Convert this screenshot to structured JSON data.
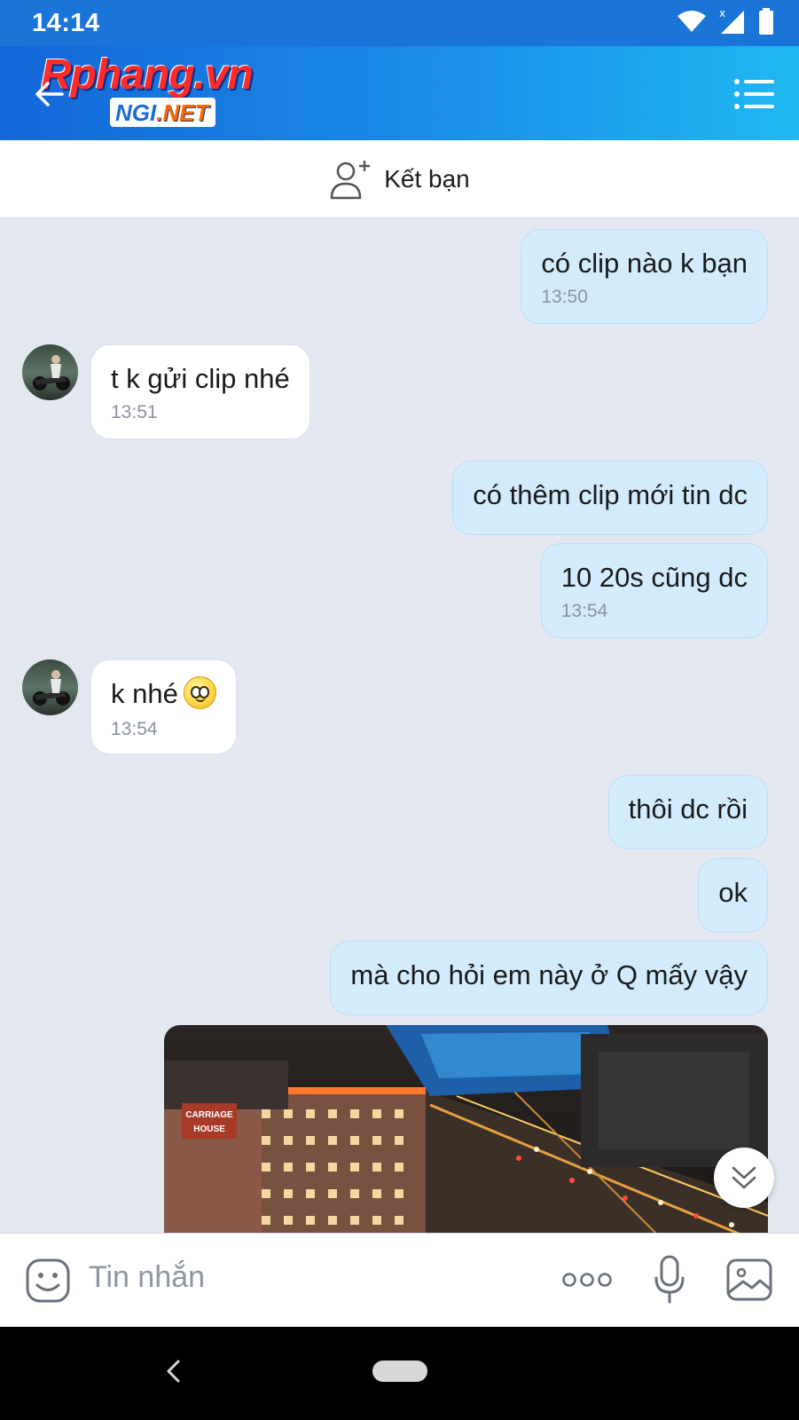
{
  "status_bar": {
    "time": "14:14"
  },
  "header": {
    "logo_main": "Rphang.vn",
    "logo_sub_a": "NGI",
    "logo_sub_b": ".NET"
  },
  "friend_bar": {
    "label": "Kết bạn"
  },
  "messages": [
    {
      "side": "out",
      "text": "có clip nào k bạn",
      "time": "13:50"
    },
    {
      "side": "in",
      "text": "t k gửi clip nhé",
      "time": "13:51"
    },
    {
      "side": "out",
      "text": "có thêm clip mới tin dc",
      "time": ""
    },
    {
      "side": "out",
      "text": "10 20s cũng dc",
      "time": "13:54"
    },
    {
      "side": "in",
      "text": "k nhé",
      "time": "13:54",
      "emoji": "smiley-emoji"
    },
    {
      "side": "out",
      "text": "thôi dc rồi",
      "time": ""
    },
    {
      "side": "out",
      "text": "ok",
      "time": ""
    },
    {
      "side": "out",
      "text": "mà cho hỏi em này ở Q mấy vậy",
      "time": ""
    }
  ],
  "photo": {
    "sign_line1": "CARRIAGE",
    "sign_line2": "HOUSE"
  },
  "input": {
    "placeholder": "Tin nhắn"
  },
  "icons": {
    "back": "back-arrow-icon",
    "menu": "menu-icon",
    "add_friend": "add-friend-icon",
    "sticker": "sticker-icon",
    "more": "more-icon",
    "mic": "microphone-icon",
    "gallery": "image-icon",
    "scroll_down": "double-chevron-down-icon"
  },
  "colors": {
    "header_start": "#1467d8",
    "header_end": "#20b8f3",
    "bubble_out": "#d3ecfd",
    "bubble_in": "#ffffff",
    "chat_bg": "#e3e8f0"
  }
}
